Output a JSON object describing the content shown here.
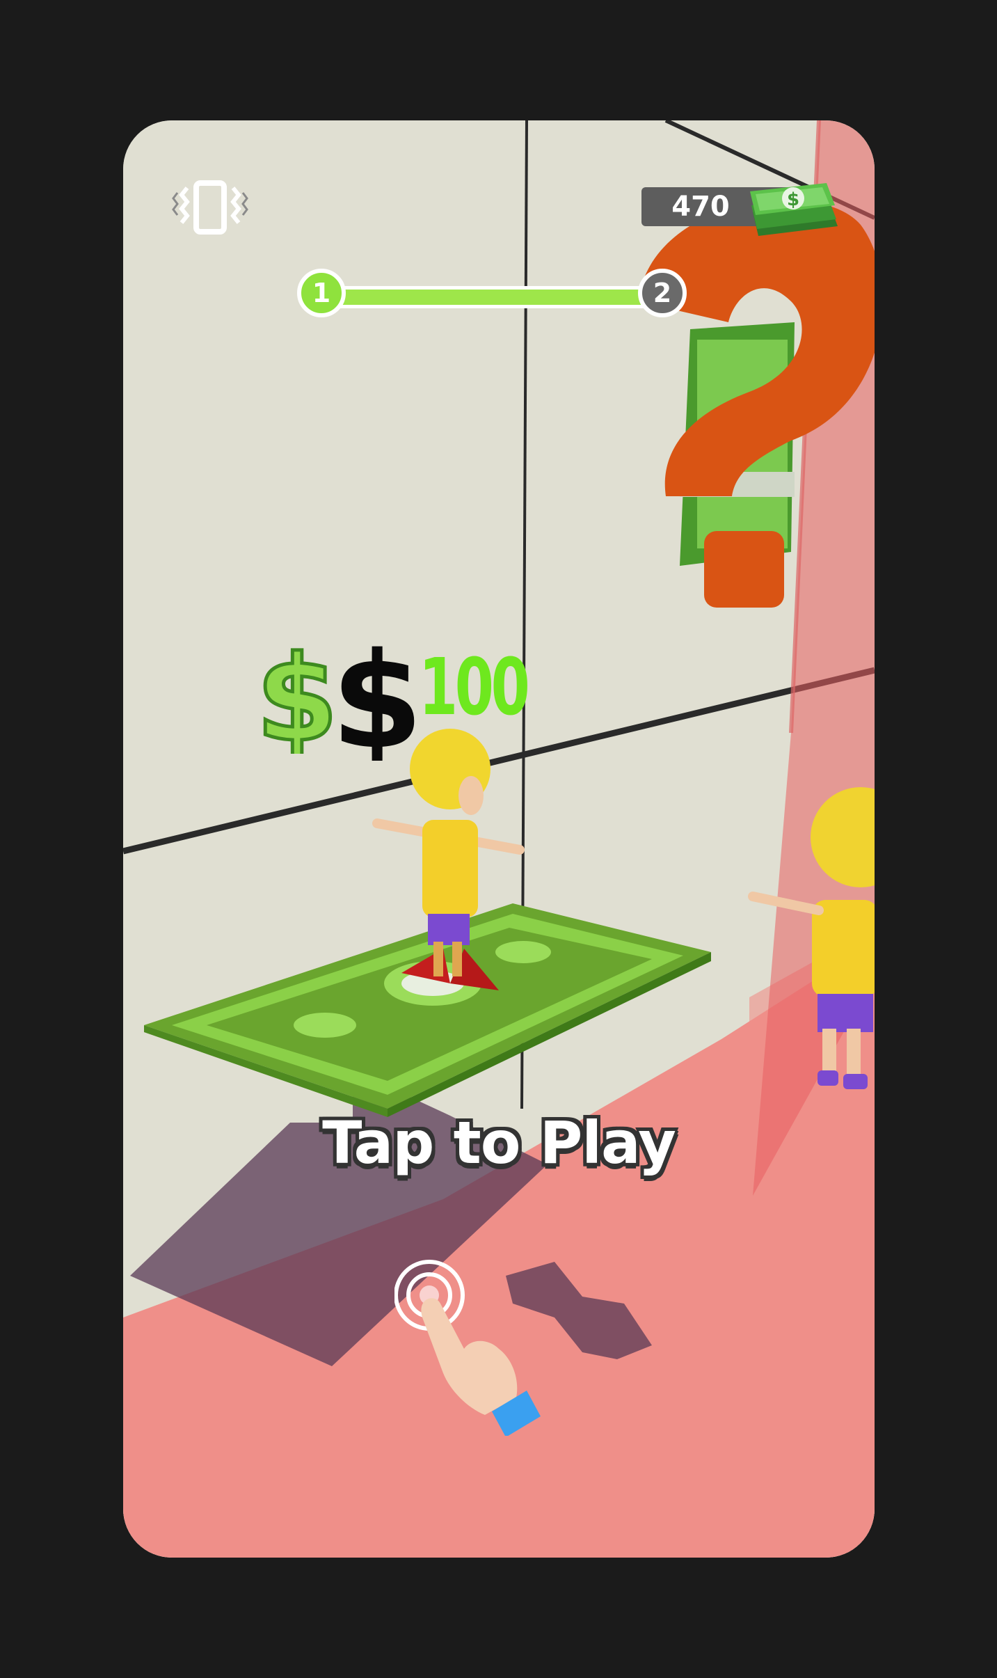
{
  "hud": {
    "money": "470",
    "vibrate_icon": "vibrate-icon",
    "money_icon": "cash-stack-icon"
  },
  "level": {
    "current": "1",
    "next": "2",
    "progress": 0
  },
  "price_label": {
    "value": "100",
    "icons": [
      "green-dollar-icon",
      "black-dollar-icon"
    ]
  },
  "prompt": {
    "text": "Tap to Play",
    "icon": "tap-hand-icon"
  },
  "colors": {
    "wall": "#e0dfd2",
    "floor": "#ef8f89",
    "accent_green": "#8fe23d",
    "price_green": "#6ee81e",
    "question_orange": "#d95414"
  }
}
